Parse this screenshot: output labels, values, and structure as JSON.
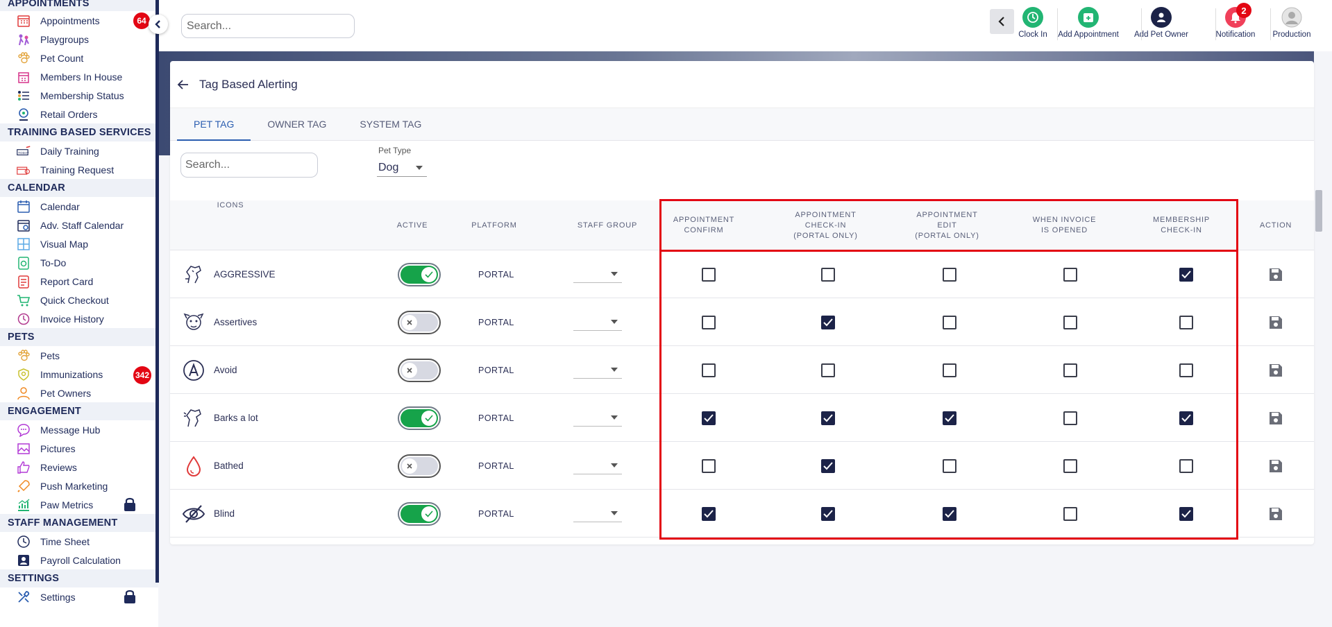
{
  "sidebar": {
    "sections": [
      {
        "title": "APPOINTMENTS",
        "items": [
          {
            "label": "Appointments",
            "icon": "calendar-grid-icon",
            "badge": "64"
          },
          {
            "label": "Playgroups",
            "icon": "playgroups-icon"
          },
          {
            "label": "Pet Count",
            "icon": "paw-icon"
          },
          {
            "label": "Members In House",
            "icon": "building-icon"
          },
          {
            "label": "Membership Status",
            "icon": "list-icon"
          },
          {
            "label": "Retail Orders",
            "icon": "retail-icon"
          }
        ]
      },
      {
        "title": "TRAINING BASED SERVICES",
        "items": [
          {
            "label": "Daily Training",
            "icon": "training-icon"
          },
          {
            "label": "Training Request",
            "icon": "training-request-icon"
          }
        ]
      },
      {
        "title": "CALENDAR",
        "items": [
          {
            "label": "Calendar",
            "icon": "calendar-icon"
          },
          {
            "label": "Adv. Staff Calendar",
            "icon": "staff-calendar-icon"
          },
          {
            "label": "Visual Map",
            "icon": "map-icon"
          },
          {
            "label": "To-Do",
            "icon": "todo-icon"
          },
          {
            "label": "Report Card",
            "icon": "report-card-icon"
          },
          {
            "label": "Quick Checkout",
            "icon": "cart-icon"
          },
          {
            "label": "Invoice History",
            "icon": "invoice-icon"
          }
        ]
      },
      {
        "title": "PETS",
        "items": [
          {
            "label": "Pets",
            "icon": "paw-icon"
          },
          {
            "label": "Immunizations",
            "icon": "immunization-icon",
            "badge": "342"
          },
          {
            "label": "Pet Owners",
            "icon": "person-icon"
          }
        ]
      },
      {
        "title": "ENGAGEMENT",
        "items": [
          {
            "label": "Message Hub",
            "icon": "message-icon"
          },
          {
            "label": "Pictures",
            "icon": "pictures-icon"
          },
          {
            "label": "Reviews",
            "icon": "thumbs-up-icon"
          },
          {
            "label": "Push Marketing",
            "icon": "rocket-icon"
          },
          {
            "label": "Paw Metrics",
            "icon": "metrics-icon",
            "locked": true
          }
        ]
      },
      {
        "title": "STAFF MANAGEMENT",
        "items": [
          {
            "label": "Time Sheet",
            "icon": "clock-icon"
          },
          {
            "label": "Payroll Calculation",
            "icon": "payroll-icon"
          }
        ]
      },
      {
        "title": "SETTINGS",
        "items": [
          {
            "label": "Settings",
            "icon": "tools-icon",
            "locked": true
          }
        ]
      }
    ]
  },
  "header": {
    "search_placeholder": "Search...",
    "actions": [
      {
        "label": "Clock In",
        "icon": "clock-icon",
        "color": "#22b573"
      },
      {
        "label": "Add Appointment",
        "icon": "add-appointment-icon",
        "color": "#22b573"
      },
      {
        "label": "Add Pet Owner",
        "icon": "add-person-icon",
        "color": "#1c2348"
      },
      {
        "label": "Notification",
        "icon": "bell-icon",
        "color": "#f0405a",
        "badge": "2"
      },
      {
        "label": "Production",
        "icon": "avatar-icon",
        "color": "#bbbbbb"
      }
    ]
  },
  "page": {
    "title": "Tag Based Alerting",
    "tabs": [
      "PET TAG",
      "OWNER TAG",
      "SYSTEM TAG"
    ],
    "active_tab": 0,
    "filter_search_placeholder": "Search...",
    "pet_type_label": "Pet Type",
    "pet_type_value": "Dog"
  },
  "table": {
    "headers": {
      "icons": "ICONS",
      "active": "ACTIVE",
      "platform": "PLATFORM",
      "staff_group": "STAFF GROUP",
      "appt_confirm": [
        "APPOINTMENT",
        "CONFIRM"
      ],
      "appt_checkin": [
        "APPOINTMENT",
        "CHECK-IN",
        "(PORTAL ONLY)"
      ],
      "appt_edit": [
        "APPOINTMENT",
        "EDIT",
        "(PORTAL ONLY)"
      ],
      "invoice_opened": [
        "WHEN INVOICE",
        "IS OPENED"
      ],
      "membership_checkin": [
        "MEMBERSHIP",
        "CHECK-IN"
      ],
      "action": "ACTION"
    },
    "rows": [
      {
        "name": "AGGRESSIVE",
        "icon": "aggressive-dog-icon",
        "active": true,
        "platform": "PORTAL",
        "checks": [
          false,
          false,
          false,
          false,
          true
        ]
      },
      {
        "name": "Assertives",
        "icon": "assertive-dog-icon",
        "active": false,
        "platform": "PORTAL",
        "checks": [
          false,
          true,
          false,
          false,
          false
        ]
      },
      {
        "name": "Avoid",
        "icon": "avoid-a-icon",
        "active": false,
        "platform": "PORTAL",
        "checks": [
          false,
          false,
          false,
          false,
          false
        ]
      },
      {
        "name": "Barks a lot",
        "icon": "barking-dog-icon",
        "active": true,
        "platform": "PORTAL",
        "checks": [
          true,
          true,
          true,
          false,
          true
        ]
      },
      {
        "name": "Bathed",
        "icon": "water-drop-icon",
        "active": false,
        "platform": "PORTAL",
        "checks": [
          false,
          true,
          false,
          false,
          false
        ]
      },
      {
        "name": "Blind",
        "icon": "eye-slash-icon",
        "active": true,
        "platform": "PORTAL",
        "checks": [
          true,
          true,
          true,
          false,
          true
        ]
      }
    ]
  },
  "colors": {
    "accent": "#2a5db0",
    "navy": "#1e2a5a",
    "highlight": "#e30613",
    "toggle_on": "#16a34a"
  }
}
